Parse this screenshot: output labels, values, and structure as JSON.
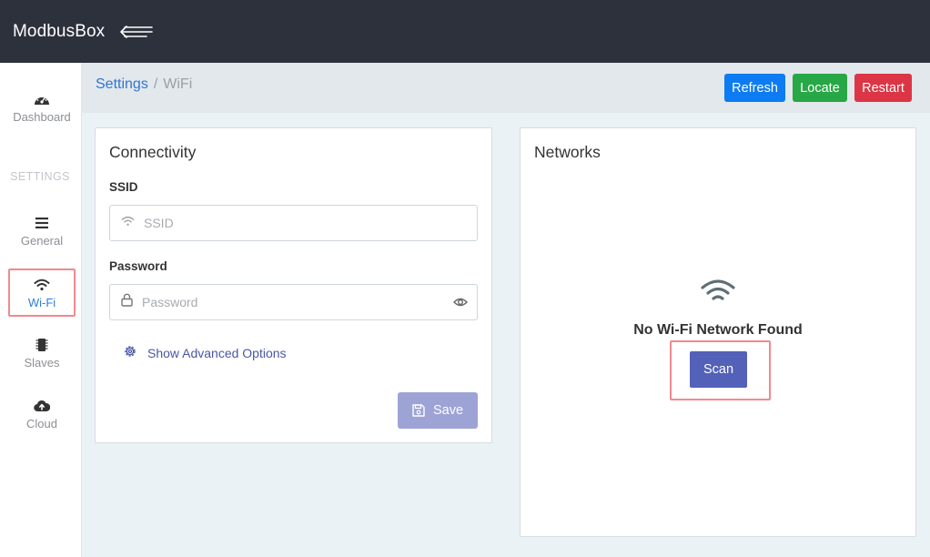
{
  "app": {
    "title": "ModbusBox"
  },
  "sidebar": {
    "items": [
      {
        "label": "Dashboard",
        "icon": "dashboard-icon"
      },
      {
        "label": "General",
        "icon": "bars-icon"
      },
      {
        "label": "Wi-Fi",
        "icon": "wifi-icon"
      },
      {
        "label": "Slaves",
        "icon": "chip-icon"
      },
      {
        "label": "Cloud",
        "icon": "cloud-upload-icon"
      }
    ],
    "section_heading": "SETTINGS",
    "active": "Wi-Fi"
  },
  "breadcrumb": {
    "parent": "Settings",
    "separator": "/",
    "current": "WiFi"
  },
  "actions": {
    "refresh": "Refresh",
    "locate": "Locate",
    "restart": "Restart"
  },
  "connectivity": {
    "title": "Connectivity",
    "ssid_label": "SSID",
    "ssid_placeholder": "SSID",
    "password_label": "Password",
    "password_placeholder": "Password",
    "advanced_link": "Show Advanced Options",
    "save_label": "Save"
  },
  "networks": {
    "title": "Networks",
    "empty_message": "No Wi-Fi Network Found",
    "scan_label": "Scan"
  },
  "colors": {
    "topbar": "#2d313c",
    "refresh": "#0d7cf2",
    "locate": "#27a745",
    "restart": "#dc3545",
    "save": "#9ea3d6",
    "scan": "#5361b8",
    "highlight": "#f08a8e"
  }
}
